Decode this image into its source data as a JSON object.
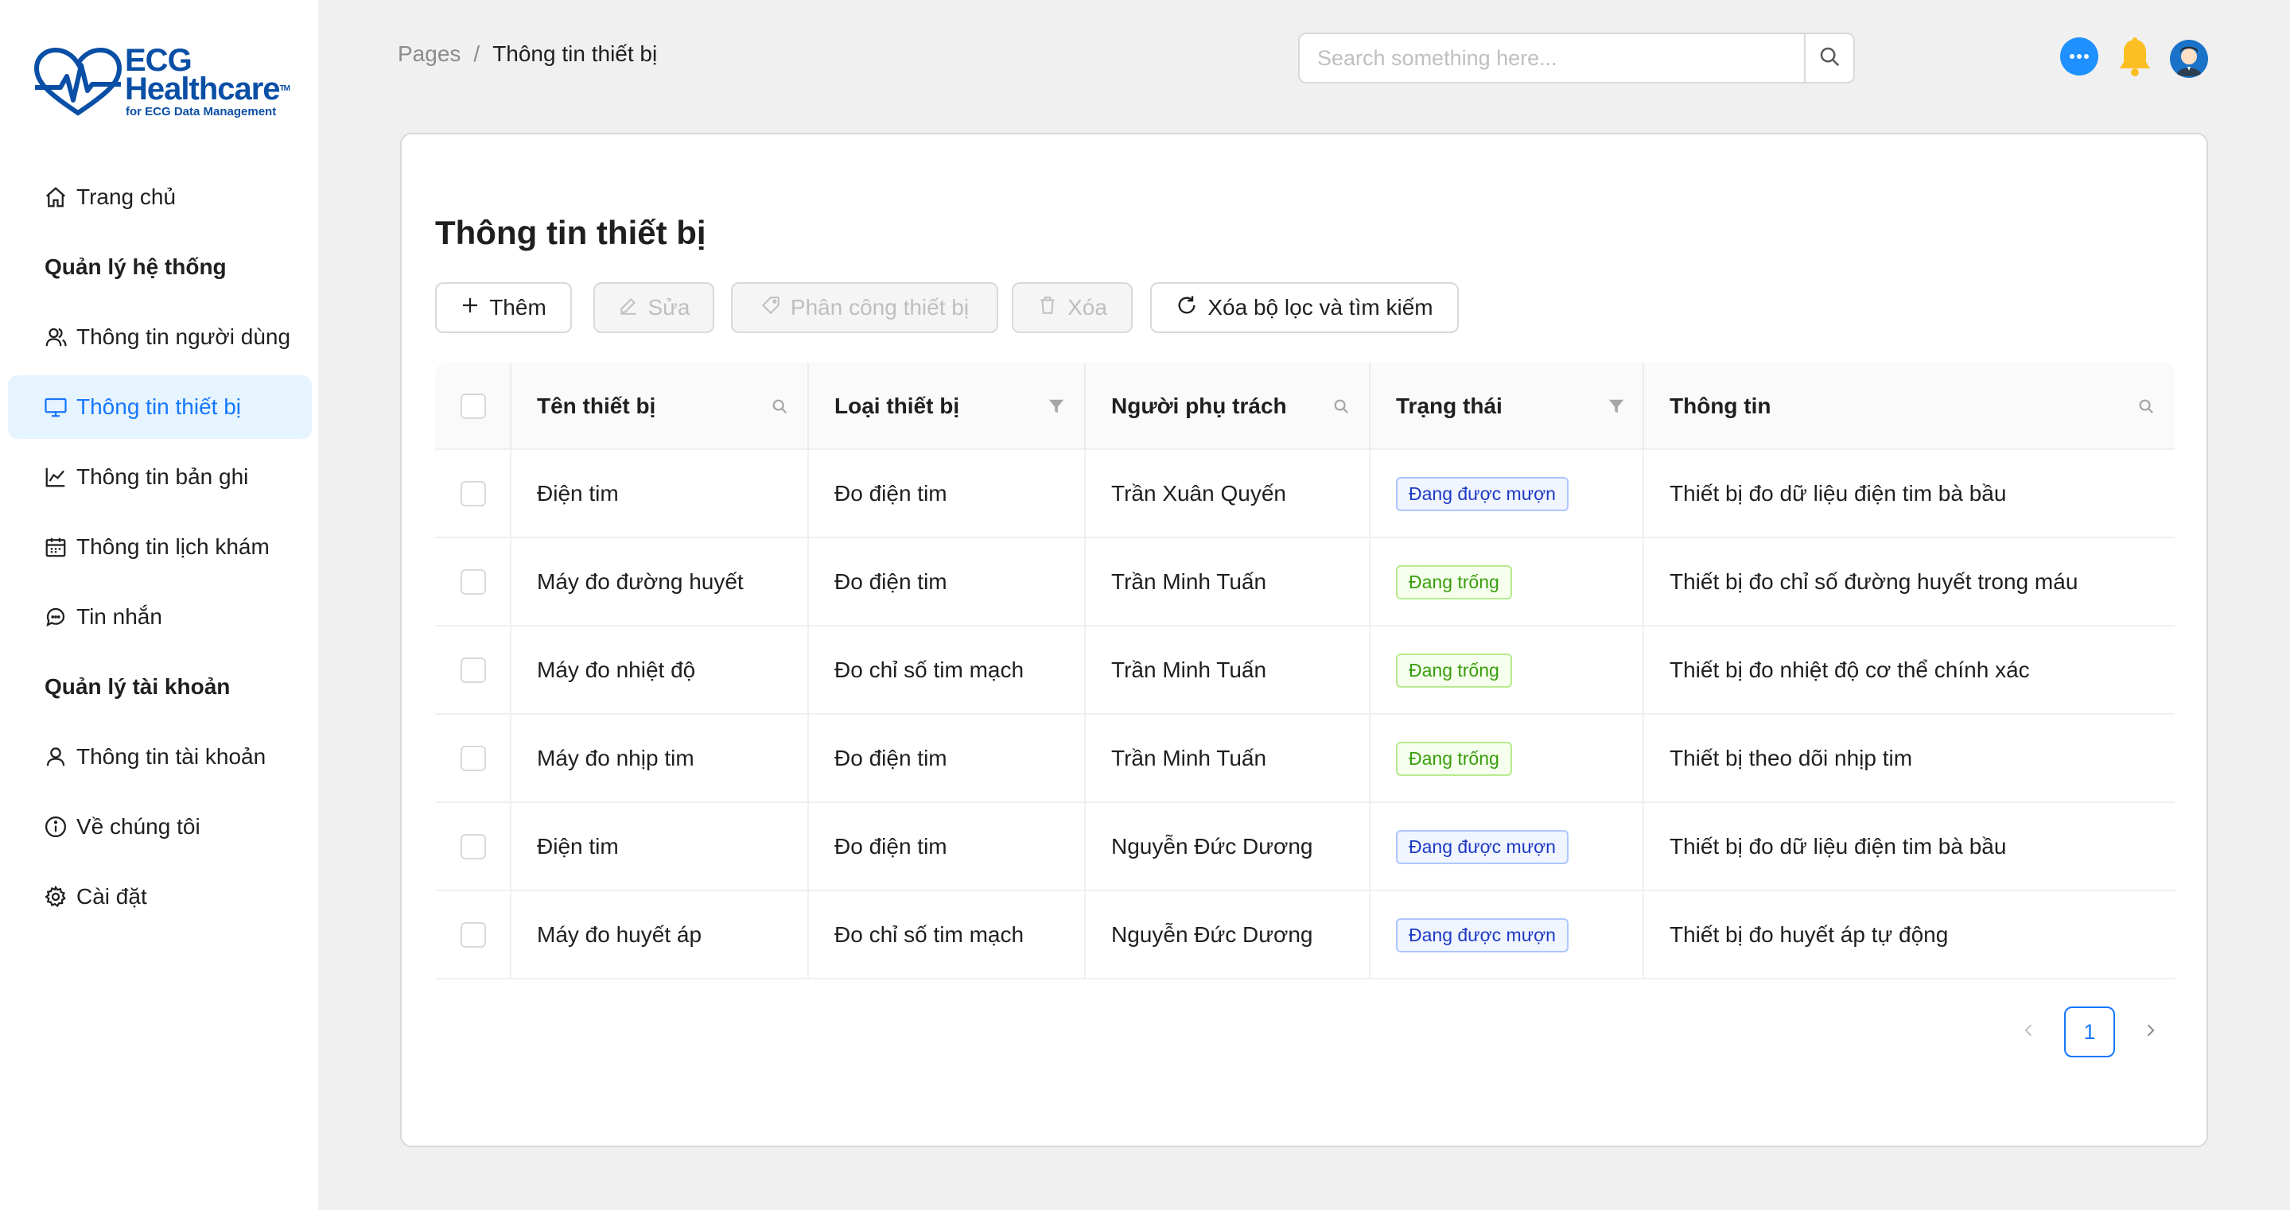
{
  "brand": {
    "line1": "ECG",
    "line2": "Healthcare",
    "tm": "TM",
    "tagline": "for ECG Data Management",
    "color": "#0a4fa6"
  },
  "sidebar": {
    "items": [
      {
        "label": "Trang chủ",
        "icon": "home-icon"
      },
      {
        "label": "Quản lý hệ thống",
        "group": true
      },
      {
        "label": "Thông tin người dùng",
        "icon": "users-icon"
      },
      {
        "label": "Thông tin thiết bị",
        "icon": "monitor-icon",
        "active": true
      },
      {
        "label": "Thông tin bản ghi",
        "icon": "line-chart-icon"
      },
      {
        "label": "Thông tin lịch khám",
        "icon": "calendar-icon"
      },
      {
        "label": "Tin nhắn",
        "icon": "message-icon"
      },
      {
        "label": "Quản lý tài khoản",
        "group": true
      },
      {
        "label": "Thông tin tài khoản",
        "icon": "user-icon"
      },
      {
        "label": "Về chúng tôi",
        "icon": "info-icon"
      },
      {
        "label": "Cài đặt",
        "icon": "settings-icon"
      }
    ]
  },
  "header": {
    "breadcrumb": {
      "root": "Pages",
      "separator": "/",
      "current": "Thông tin thiết bị"
    },
    "search": {
      "placeholder": "Search something here...",
      "value": ""
    },
    "icons": [
      "chat-icon",
      "bell-icon",
      "avatar"
    ]
  },
  "main": {
    "title": "Thông tin thiết bị",
    "toolbar": {
      "add": "Thêm",
      "edit": "Sửa",
      "assign": "Phân công thiết bị",
      "delete": "Xóa",
      "reset": "Xóa bộ lọc và tìm kiếm"
    },
    "table": {
      "columns": [
        "Tên thiết bị",
        "Loại thiết bị",
        "Người phụ trách",
        "Trạng thái",
        "Thông tin"
      ],
      "rows": [
        {
          "name": "Điện tim",
          "type": "Đo điện tim",
          "owner": "Trần Xuân Quyến",
          "status": "Đang được mượn",
          "status_kind": "blue",
          "info": "Thiết bị đo dữ liệu điện tim bà bầu"
        },
        {
          "name": "Máy đo đường huyết",
          "type": "Đo điện tim",
          "owner": "Trần Minh Tuấn",
          "status": "Đang trống",
          "status_kind": "green",
          "info": "Thiết bị đo chỉ số đường huyết trong máu"
        },
        {
          "name": "Máy đo nhiệt độ",
          "type": "Đo chỉ số tim mạch",
          "owner": "Trần Minh Tuấn",
          "status": "Đang trống",
          "status_kind": "green",
          "info": "Thiết bị đo nhiệt độ cơ thể chính xác"
        },
        {
          "name": "Máy đo nhịp tim",
          "type": "Đo điện tim",
          "owner": "Trần Minh Tuấn",
          "status": "Đang trống",
          "status_kind": "green",
          "info": "Thiết bị theo dõi nhịp tim"
        },
        {
          "name": "Điện tim",
          "type": "Đo điện tim",
          "owner": "Nguyễn Đức Dương",
          "status": "Đang được mượn",
          "status_kind": "blue",
          "info": "Thiết bị đo dữ liệu điện tim bà bầu"
        },
        {
          "name": "Máy đo huyết áp",
          "type": "Đo chỉ số tim mạch",
          "owner": "Nguyễn Đức Dương",
          "status": "Đang được mượn",
          "status_kind": "blue",
          "info": "Thiết bị đo huyết áp tự động"
        }
      ]
    },
    "pagination": {
      "current": "1"
    }
  }
}
